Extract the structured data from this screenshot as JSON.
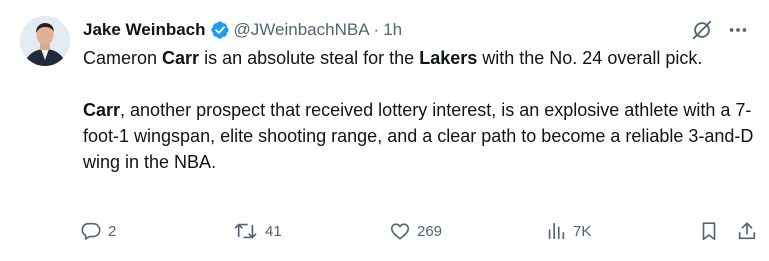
{
  "author": {
    "display_name": "Jake Weinbach",
    "handle": "@JWeinbachNBA",
    "separator": "·",
    "time": "1h"
  },
  "post": {
    "p1_a": "Cameron ",
    "p1_b": "Carr",
    "p1_c": " is an absolute steal for the ",
    "p1_d": "Lakers",
    "p1_e": " with the No. 24 overall pick.",
    "p2_a": "Carr",
    "p2_b": ", another prospect that received lottery interest, is an explosive athlete with a 7-foot-1 wingspan, elite shooting range, and a clear path to become a reliable 3-and-D wing in the NBA."
  },
  "actions": {
    "replies": "2",
    "reposts": "41",
    "likes": "269",
    "views": "7K"
  },
  "icons": {
    "verified": "verified-badge-icon",
    "grok": "grok-icon",
    "more": "more-icon",
    "reply": "reply-icon",
    "repost": "repost-icon",
    "like": "heart-icon",
    "views": "views-icon",
    "bookmark": "bookmark-icon",
    "share": "share-icon"
  },
  "colors": {
    "verified": "#1d9bf0",
    "text": "#0f1419",
    "muted": "#536471"
  }
}
